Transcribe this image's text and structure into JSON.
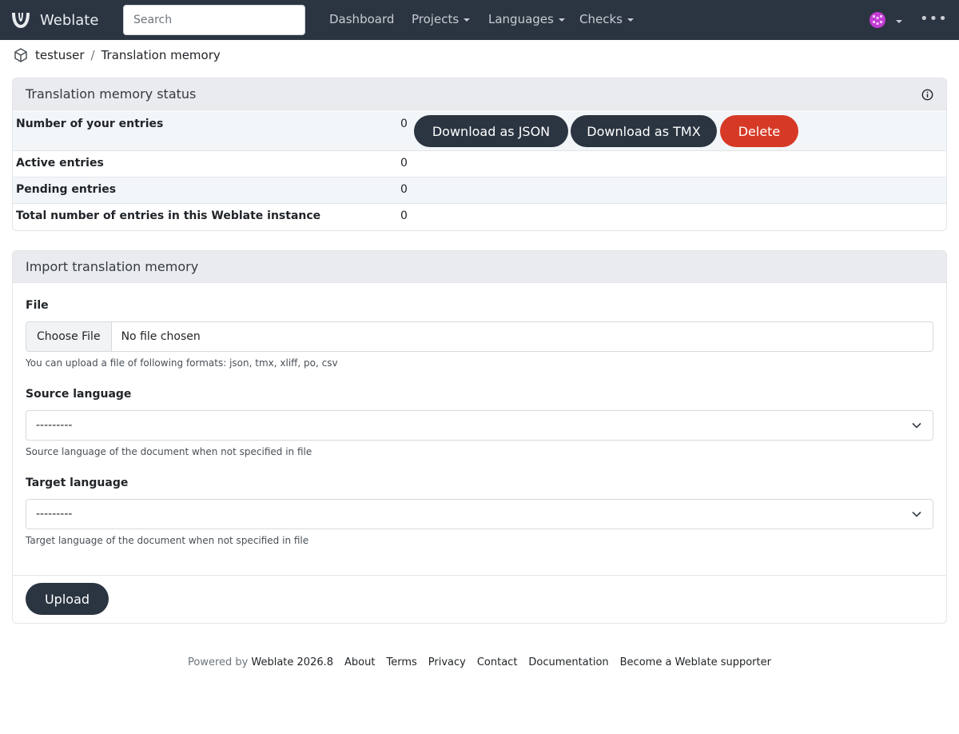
{
  "navbar": {
    "brand": "Weblate",
    "search_placeholder": "Search",
    "items": [
      "Dashboard",
      "Projects",
      "Languages",
      "Checks"
    ]
  },
  "breadcrumb": {
    "user": "testuser",
    "separator": "/",
    "page": "Translation memory"
  },
  "status": {
    "title": "Translation memory status",
    "rows": [
      {
        "label": "Number of your entries",
        "value": "0"
      },
      {
        "label": "Active entries",
        "value": "0"
      },
      {
        "label": "Pending entries",
        "value": "0"
      },
      {
        "label": "Total number of entries in this Weblate instance",
        "value": "0"
      }
    ],
    "buttons": {
      "download_json": "Download as JSON",
      "download_tmx": "Download as TMX",
      "delete": "Delete"
    }
  },
  "import": {
    "title": "Import translation memory",
    "file": {
      "label": "File",
      "button": "Choose File",
      "status": "No file chosen",
      "help": "You can upload a file of following formats: json, tmx, xliff, po, csv"
    },
    "source_language": {
      "label": "Source language",
      "value": "---------",
      "help": "Source language of the document when not specified in file"
    },
    "target_language": {
      "label": "Target language",
      "value": "---------",
      "help": "Target language of the document when not specified in file"
    },
    "upload_button": "Upload"
  },
  "footer": {
    "powered_by": "Powered by",
    "version": "Weblate 2026.8",
    "links": [
      "About",
      "Terms",
      "Privacy",
      "Contact",
      "Documentation",
      "Become a Weblate supporter"
    ]
  },
  "colors": {
    "navbar_bg": "#2b3441",
    "button_dark": "#2b3441",
    "button_danger": "#d63a26",
    "avatar": "#c23bd4"
  },
  "icons": {
    "brand": "weblate-logo-icon",
    "breadcrumb": "cube-icon",
    "info": "info-icon",
    "avatar": "user-avatar-icon",
    "more": "more-dots-icon",
    "select_chevron": "chevron-down-icon"
  }
}
